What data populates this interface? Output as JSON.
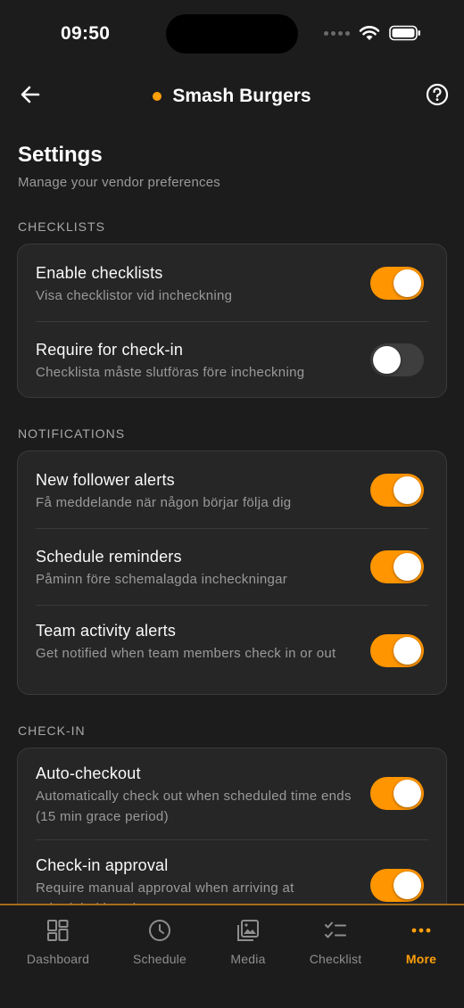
{
  "status_bar": {
    "time": "09:50"
  },
  "header": {
    "title": "Smash Burgers",
    "back_icon": "arrow-left-icon",
    "help_icon": "question-circle-icon"
  },
  "page": {
    "title": "Settings",
    "subtitle": "Manage your vendor preferences"
  },
  "sections": [
    {
      "label": "CHECKLISTS",
      "items": [
        {
          "title": "Enable checklists",
          "description": "Visa checklistor vid incheckning",
          "enabled": true
        },
        {
          "title": "Require for check-in",
          "description": "Checklista måste slutföras före incheckning",
          "enabled": false
        }
      ]
    },
    {
      "label": "NOTIFICATIONS",
      "items": [
        {
          "title": "New follower alerts",
          "description": "Få meddelande när någon börjar följa dig",
          "enabled": true
        },
        {
          "title": "Schedule reminders",
          "description": "Påminn före schemalagda incheckningar",
          "enabled": true
        },
        {
          "title": "Team activity alerts",
          "description": "Get notified when team members check in or out",
          "enabled": true
        }
      ]
    },
    {
      "label": "CHECK-IN",
      "items": [
        {
          "title": "Auto-checkout",
          "description": "Automatically check out when scheduled time ends (15 min grace period)",
          "enabled": true
        },
        {
          "title": "Check-in approval",
          "description": "Require manual approval when arriving at scheduled locations",
          "enabled": true
        }
      ]
    }
  ],
  "tabs": [
    {
      "label": "Dashboard",
      "icon": "dashboard-icon",
      "active": false
    },
    {
      "label": "Schedule",
      "icon": "clock-icon",
      "active": false
    },
    {
      "label": "Media",
      "icon": "image-icon",
      "active": false
    },
    {
      "label": "Checklist",
      "icon": "checklist-icon",
      "active": false
    },
    {
      "label": "More",
      "icon": "more-dots-icon",
      "active": true
    }
  ],
  "colors": {
    "accent": "#ff9500",
    "background": "#1c1c1c",
    "card": "#262626"
  }
}
